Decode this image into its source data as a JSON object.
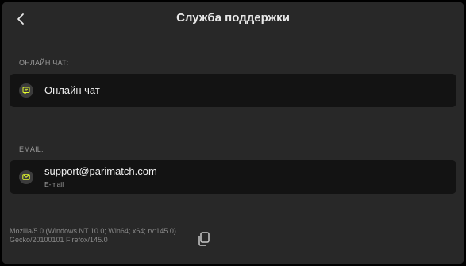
{
  "header": {
    "title": "Служба поддержки"
  },
  "sections": {
    "online_chat": {
      "label": "ОНЛАЙН ЧАТ:",
      "item_title": "Онлайн чат"
    },
    "email": {
      "label": "EMAIL:",
      "item_title": "support@parimatch.com",
      "item_subtitle": "E-mail"
    }
  },
  "footer": {
    "user_agent_line1": "Mozilla/5.0 (Windows NT 10.0; Win64; x64; rv:145.0)",
    "user_agent_line2": "Gecko/20100101 Firefox/145.0"
  },
  "colors": {
    "accent": "#e6ff2e",
    "background": "#282828",
    "card": "#131313"
  },
  "icons": {
    "back": "chevron-left-icon",
    "chat": "chat-icon",
    "email": "envelope-icon",
    "copy": "copy-icon"
  }
}
